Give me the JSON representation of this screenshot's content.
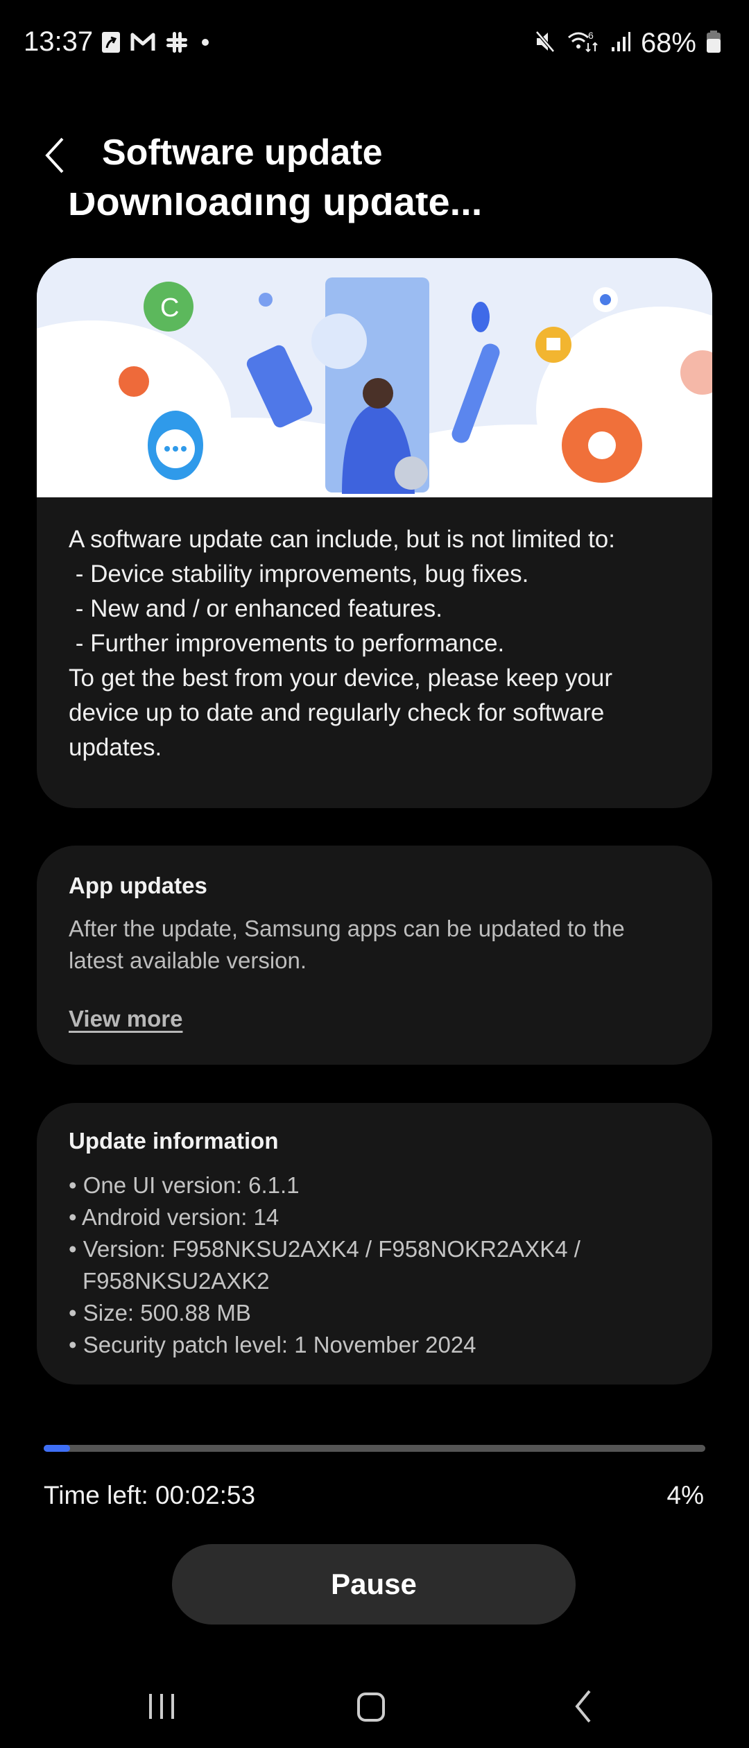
{
  "status_bar": {
    "time": "13:37",
    "notification_icons": [
      "upload-arrow-icon",
      "gmail-icon",
      "slack-icon",
      "more-dot-icon"
    ],
    "system_icons": [
      "mute-icon",
      "wifi-6-icon",
      "signal-icon",
      "battery-icon"
    ],
    "battery_percent": "68%"
  },
  "header": {
    "back_label": "Back",
    "title": "Software update",
    "subtitle": "Downloading update..."
  },
  "intro_card": {
    "illustration": "software-update-illustration",
    "lines": [
      "A software update can include, but is not limited to:",
      " - Device stability improvements, bug fixes.",
      " - New and / or enhanced features.",
      " - Further improvements to performance.",
      "To get the best from your device, please keep your",
      "device up to date and regularly check for software",
      "updates."
    ]
  },
  "app_updates": {
    "title": "App updates",
    "description": "After the update, Samsung apps can be updated to the latest available version.",
    "link": "View more"
  },
  "update_info": {
    "title": "Update information",
    "items": [
      "• One UI version: 6.1.1",
      "• Android version: 14",
      "• Version: F958NKSU2AXK4 / F958NOKR2AXK4 / F958NKSU2AXK2",
      "• Size: 500.88 MB",
      "• Security patch level: 1 November 2024"
    ]
  },
  "progress": {
    "percent_value": 4,
    "percent_label": "4%",
    "time_left": "Time left: 00:02:53",
    "fill_color": "#3f6ff5",
    "track_color": "#555555"
  },
  "actions": {
    "pause_label": "Pause"
  },
  "nav_bar": {
    "recents": "Recent apps",
    "home": "Home",
    "back": "Back"
  }
}
